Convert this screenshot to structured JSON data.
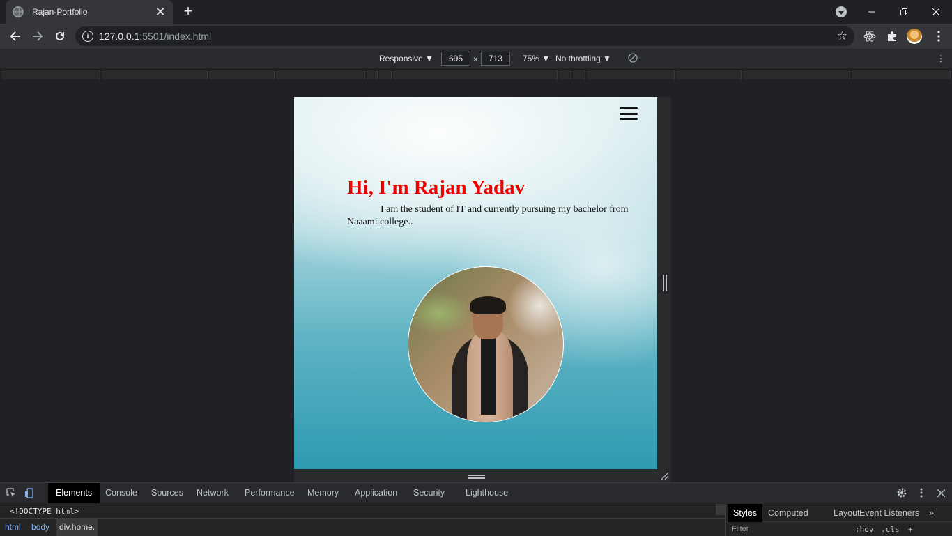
{
  "browser": {
    "tab_title": "Rajan-Portfolio",
    "tab_close": "✕",
    "new_tab": "+",
    "url_host": "127.0.0.1",
    "url_rest": ":5501/index.html",
    "star": "☆"
  },
  "device_toolbar": {
    "mode": "Responsive ▼",
    "width": "695",
    "times": "×",
    "height": "713",
    "zoom": "75% ▼",
    "throttling": "No throttling ▼",
    "more": "⋮"
  },
  "page": {
    "greeting": "Hi, I'm Rajan Yadav",
    "intro": "I am the student of IT and currently pursuing my bachelor from Naaami college..",
    "accent_color": "#ee0000"
  },
  "devtools": {
    "tabs": [
      "Elements",
      "Console",
      "Sources",
      "Network",
      "Performance",
      "Memory",
      "Application",
      "Security",
      "Lighthouse"
    ],
    "doctype": "<!DOCTYPE html>",
    "breadcrumbs": [
      "html",
      "body",
      "div.home."
    ],
    "side_tabs": [
      "Styles",
      "Computed",
      "Layout",
      "Event Listeners",
      "»"
    ],
    "filter_placeholder": "Filter",
    "hov": ":hov",
    "cls": ".cls",
    "plus": "+"
  }
}
